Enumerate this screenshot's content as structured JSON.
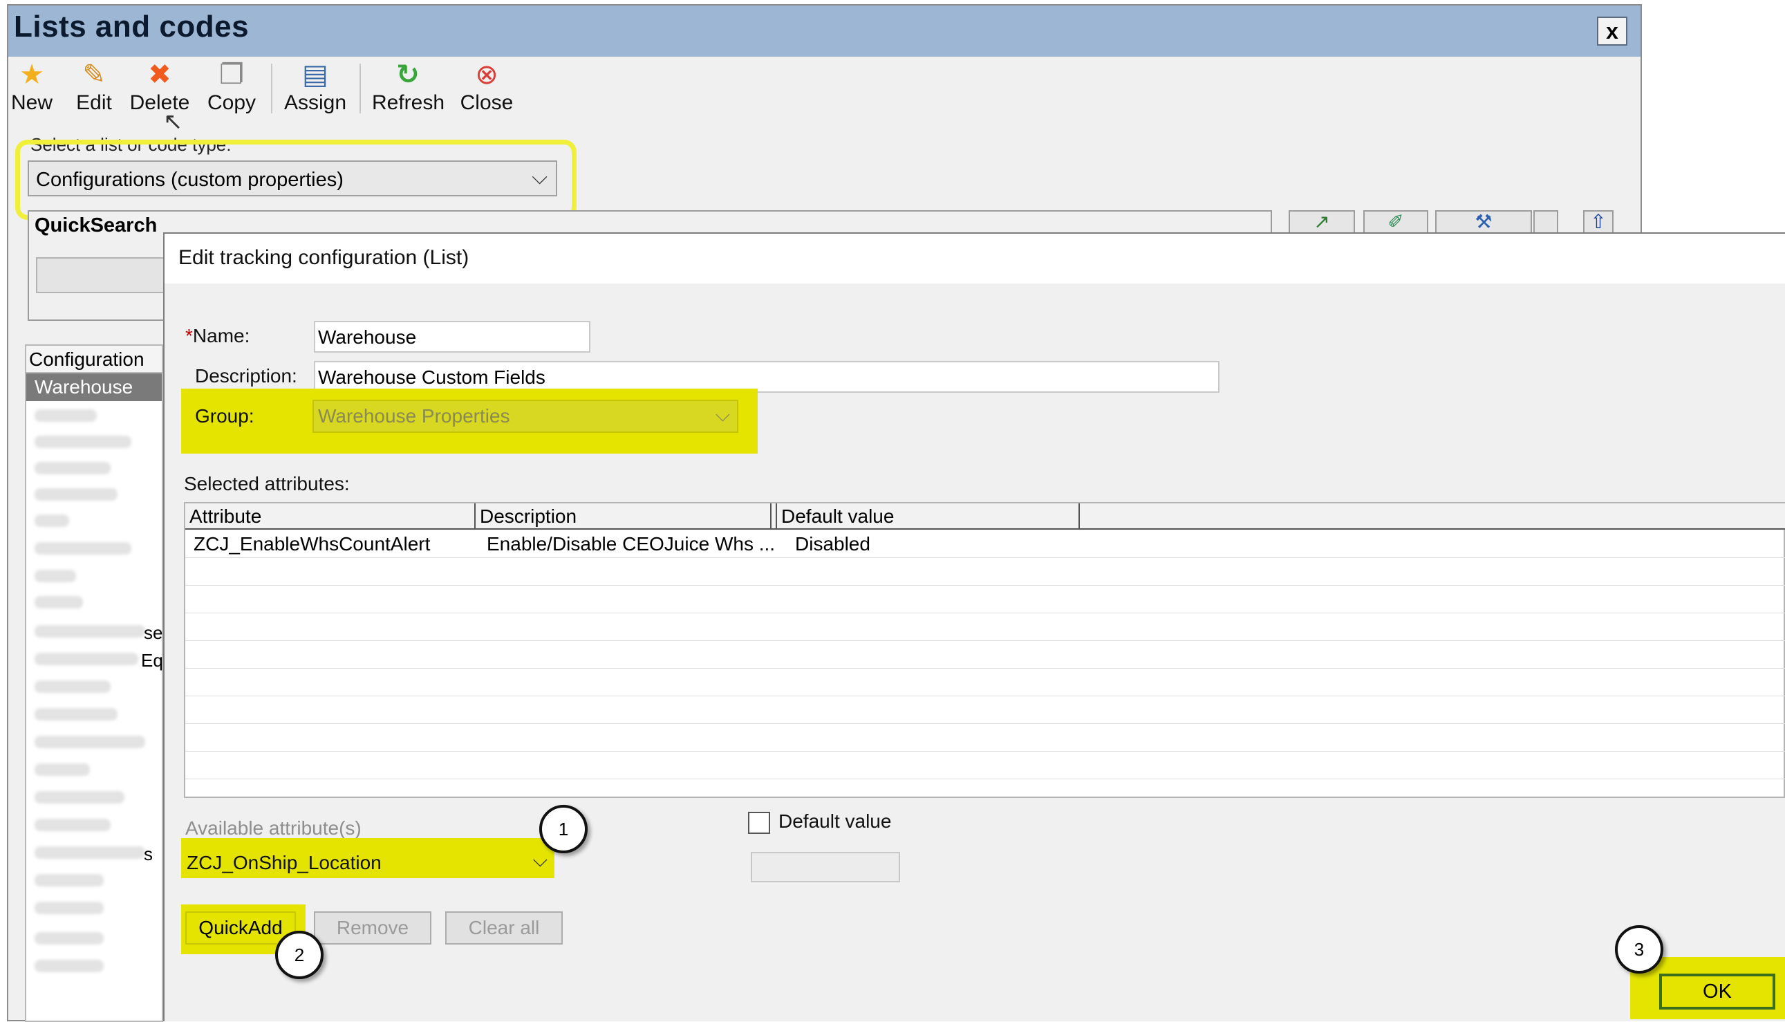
{
  "window": {
    "title": "Lists and codes",
    "close_label": "x"
  },
  "toolbar": {
    "new": "New",
    "edit": "Edit",
    "delete": "Delete",
    "copy": "Copy",
    "assign": "Assign",
    "refresh": "Refresh",
    "close": "Close"
  },
  "list_type": {
    "label": "Select a list or code type:",
    "value": "Configurations (custom properties)"
  },
  "quicksearch": {
    "label": "QuickSearch"
  },
  "left_list": {
    "header": "Configuration",
    "selected": "Warehouse",
    "partial_fragments": [
      "se",
      "Eq.",
      "s"
    ]
  },
  "dialog": {
    "title": "Edit tracking configuration (List)",
    "name_label": "Name:",
    "name_required_mark": "*",
    "name_value": "Warehouse",
    "description_label": "Description:",
    "description_value": "Warehouse Custom Fields",
    "group_label": "Group:",
    "group_value": "Warehouse Properties",
    "selected_attributes_label": "Selected attributes:",
    "grid": {
      "columns": [
        "Attribute",
        "Description",
        "Default value"
      ],
      "rows": [
        {
          "attribute": "ZCJ_EnableWhsCountAlert",
          "description": "Enable/Disable CEOJuice Whs ...",
          "default_value": "Disabled"
        }
      ]
    },
    "available_label": "Available attribute(s)",
    "available_value": "ZCJ_OnShip_Location",
    "default_value_label": "Default value",
    "buttons": {
      "quickadd": "QuickAdd",
      "remove": "Remove",
      "clear_all": "Clear all",
      "ok": "OK"
    }
  },
  "callouts": {
    "one": "1",
    "two": "2",
    "three": "3"
  },
  "colors": {
    "highlight": "#e4e400",
    "title_bar": "#9db6d4",
    "ok_border": "#3a6e1d"
  }
}
